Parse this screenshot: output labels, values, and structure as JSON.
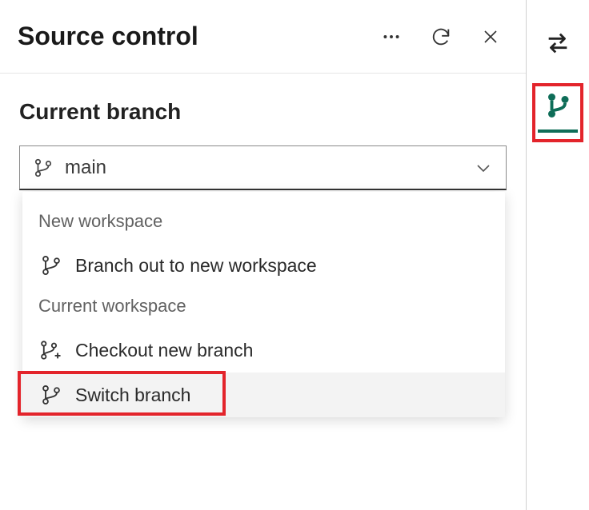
{
  "header": {
    "title": "Source control",
    "icons": {
      "more": "more-icon",
      "refresh": "refresh-icon",
      "close": "close-icon"
    }
  },
  "section": {
    "label": "Current branch"
  },
  "dropdown": {
    "value": "main",
    "groups": {
      "new_workspace": {
        "label": "New workspace",
        "items": [
          {
            "label": "Branch out to new workspace"
          }
        ]
      },
      "current_workspace": {
        "label": "Current workspace",
        "items": [
          {
            "label": "Checkout new branch"
          },
          {
            "label": "Switch branch"
          }
        ]
      }
    }
  },
  "rail": {
    "sync_icon": "swap-icon",
    "branch_icon": "git-branch-icon"
  },
  "colors": {
    "highlight": "#e3242b",
    "accent": "#0e6d58"
  }
}
